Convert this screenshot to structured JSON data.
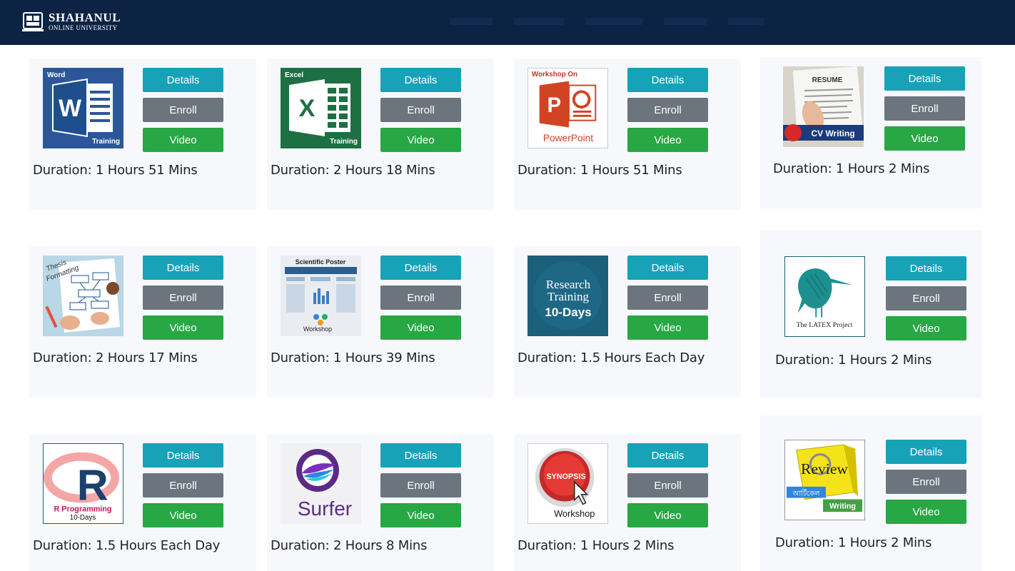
{
  "header": {
    "logo_title": "SHAHANUL",
    "logo_subtitle": "ONLINE UNIVERSITY"
  },
  "colors": {
    "header_bg": "#0c2344",
    "details": "#17a2b8",
    "enroll": "#6c757d",
    "video": "#28a745"
  },
  "buttons": {
    "details": "Details",
    "enroll": "Enroll",
    "video": "Video"
  },
  "courses": [
    {
      "thumb_icon": "word-icon",
      "thumb_text": [
        "Word",
        "Training"
      ],
      "duration": "Duration: 1 Hours 51 Mins"
    },
    {
      "thumb_icon": "excel-icon",
      "thumb_text": [
        "Excel",
        "Training"
      ],
      "duration": "Duration: 2 Hours 18 Mins"
    },
    {
      "thumb_icon": "powerpoint-icon",
      "thumb_text": [
        "Workshop On",
        "PowerPoint"
      ],
      "duration": "Duration: 1 Hours 51 Mins"
    },
    {
      "thumb_icon": "resume-icon",
      "thumb_text": [
        "RESUME",
        "CV Writing"
      ],
      "duration": "Duration: 1 Hours 2 Mins"
    },
    {
      "thumb_icon": "thesis-icon",
      "thumb_text": [
        "Thesis",
        "Formatting"
      ],
      "duration": "Duration: 2 Hours 17 Mins"
    },
    {
      "thumb_icon": "poster-icon",
      "thumb_text": [
        "Scientific Poster",
        "Workshop"
      ],
      "duration": "Duration: 1 Hours 39 Mins"
    },
    {
      "thumb_icon": "research-icon",
      "thumb_text": [
        "Research",
        "Training",
        "10-Days"
      ],
      "duration": "Duration: 1.5 Hours Each Day"
    },
    {
      "thumb_icon": "latex-icon",
      "thumb_text": [
        "The LATEX Project"
      ],
      "duration": "Duration: 1 Hours 2 Mins"
    },
    {
      "thumb_icon": "r-icon",
      "thumb_text": [
        "R Programming",
        "10-Days"
      ],
      "duration": "Duration: 1.5 Hours Each Day"
    },
    {
      "thumb_icon": "surfer-icon",
      "thumb_text": [
        "Surfer"
      ],
      "duration": "Duration: 2 Hours 8 Mins"
    },
    {
      "thumb_icon": "synopsis-icon",
      "thumb_text": [
        "SYNOPSIS",
        "Workshop"
      ],
      "duration": "Duration: 1 Hours 2 Mins"
    },
    {
      "thumb_icon": "review-icon",
      "thumb_text": [
        "Review",
        "আর্টিকেল",
        "Writing"
      ],
      "duration": "Duration: 1 Hours 2 Mins"
    }
  ]
}
